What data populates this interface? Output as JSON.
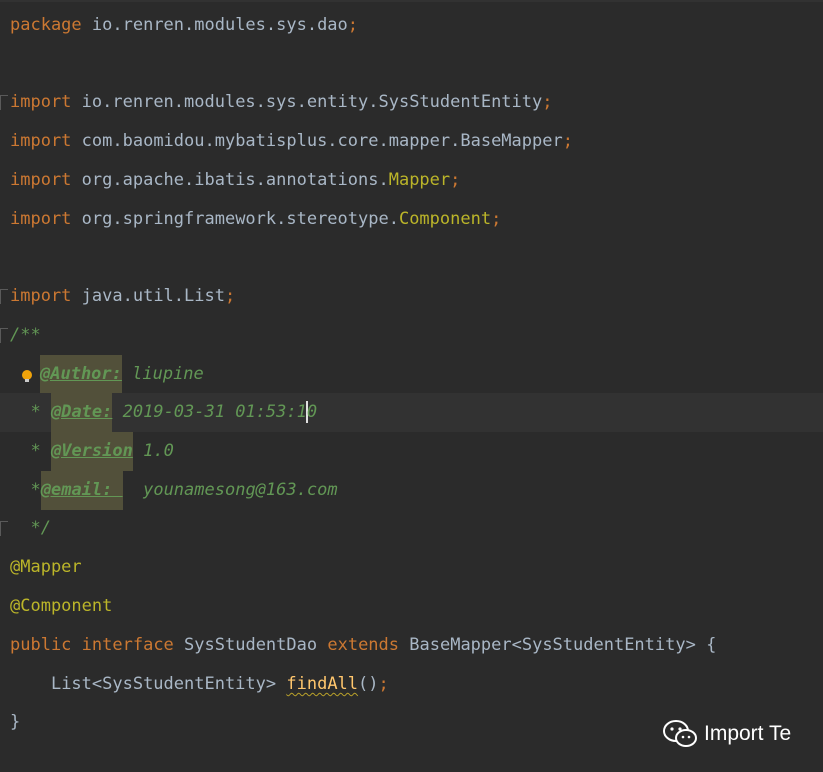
{
  "editor": {
    "lines": {
      "package": {
        "keyword": "package",
        "name": "io.renren.modules.sys.dao",
        "semicolon": ";"
      },
      "import1": {
        "keyword": "import",
        "path": "io.renren.modules.sys.entity.SysStudentEntity",
        "semicolon": ";"
      },
      "import2": {
        "keyword": "import",
        "path": "com.baomidou.mybatisplus.core.mapper.BaseMapper",
        "semicolon": ";"
      },
      "import3": {
        "keyword": "import",
        "path": "org.apache.ibatis.annotations.",
        "cls": "Mapper",
        "semicolon": ";"
      },
      "import4": {
        "keyword": "import",
        "path": "org.springframework.stereotype.",
        "cls": "Component",
        "semicolon": ";"
      },
      "import5": {
        "keyword": "import",
        "path": "java.util.List",
        "semicolon": ";"
      },
      "doc_open": "/**",
      "doc_author": {
        "tag": "@Author:",
        "value": " liupine"
      },
      "doc_date": {
        "star": "* ",
        "tag": "@Date:",
        "value_a": " 2019-03-31 01:53:1",
        "value_b": "0"
      },
      "doc_version": {
        "star": "* ",
        "tag": "@Version",
        "value": " 1.0"
      },
      "doc_email": {
        "star": "*",
        "tag": "@email: ",
        "value": "  younamesong@163.com"
      },
      "doc_close": "*/",
      "annotation1": "@Mapper",
      "annotation2": "@Component",
      "declaration": {
        "kw_public": "public",
        "kw_interface": "interface",
        "name": "SysStudentDao",
        "kw_extends": "extends",
        "base": "BaseMapper<SysStudentEntity>",
        "brace": "{"
      },
      "method": {
        "type": "List<SysStudentEntity>",
        "name": "findAll",
        "parens": "()",
        "semicolon": ";"
      },
      "closing_brace": "}"
    }
  },
  "watermark": {
    "icon": "wechat-icon",
    "text": "Import Te"
  },
  "colors": {
    "background": "#2b2b2b",
    "keyword": "#cc7832",
    "text": "#a9b7c6",
    "annotation": "#bbb529",
    "doc_comment": "#629755",
    "method": "#ffc66d",
    "highlight": "#52503a"
  }
}
